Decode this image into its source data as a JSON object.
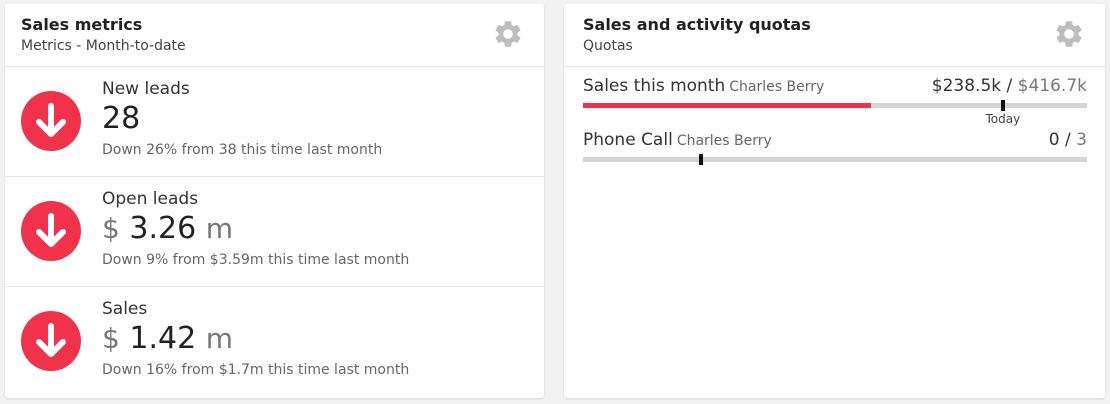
{
  "colors": {
    "accent_red": "#f0334b",
    "track_gray": "#d4d4d4",
    "gear_gray": "#bdbdbd"
  },
  "sales_metrics": {
    "title": "Sales metrics",
    "subtitle": "Metrics - Month-to-date",
    "settings_icon": "gear-icon",
    "metrics": [
      {
        "label": "New leads",
        "currency": "",
        "value": "28",
        "unit": "",
        "comparison": "Down 26% from 38 this time last month",
        "trend_icon": "down-arrow-icon"
      },
      {
        "label": "Open leads",
        "currency": "$",
        "value": "3.26",
        "unit": "m",
        "comparison": "Down 9% from $3.59m this time last month",
        "trend_icon": "down-arrow-icon"
      },
      {
        "label": "Sales",
        "currency": "$",
        "value": "1.42",
        "unit": "m",
        "comparison": "Down 16% from $1.7m this time last month",
        "trend_icon": "down-arrow-icon"
      }
    ]
  },
  "quotas": {
    "title": "Sales and activity quotas",
    "subtitle": "Quotas",
    "settings_icon": "gear-icon",
    "items": [
      {
        "name": "Sales this month",
        "owner": "Charles Berry",
        "current": "$238.5k",
        "separator": " / ",
        "target": "$416.7k",
        "progress": 0.572,
        "today_position": 0.833,
        "today_label": "Today"
      },
      {
        "name": "Phone Call",
        "owner": "Charles Berry",
        "current": "0",
        "separator": " / ",
        "target": "3",
        "progress": 0,
        "today_position": 0.235,
        "today_label": ""
      }
    ]
  }
}
